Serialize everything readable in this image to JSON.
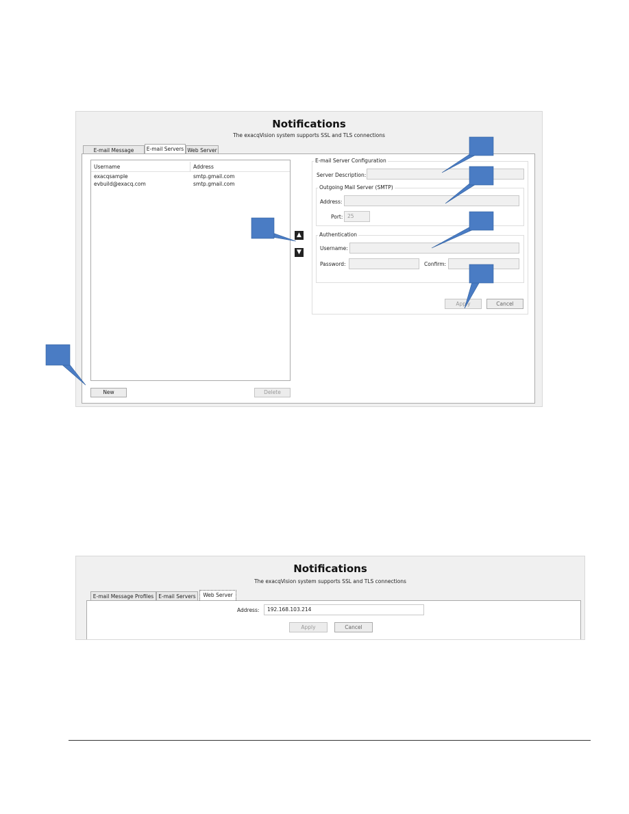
{
  "screen1": {
    "title": "Notifications",
    "subtitle": "The exacqVision system supports SSL and TLS connections",
    "tabs": [
      "E-mail Message Profiles",
      "E-mail Servers",
      "Web Server"
    ],
    "active_tab": "E-mail Servers",
    "list": {
      "columns": [
        "Username",
        "Address"
      ],
      "rows": [
        [
          "exacqsample",
          "smtp.gmail.com"
        ],
        [
          "evbuild@exacq.com",
          "smtp.gmail.com"
        ]
      ]
    },
    "new_label": "New",
    "delete_label": "Delete",
    "config": {
      "group_title": "E-mail Server Configuration",
      "server_description_label": "Server Description:",
      "smtp_title": "Outgoing Mail Server (SMTP)",
      "address_label": "Address:",
      "port_label": "Port:",
      "port_value": "25",
      "auth_title": "Authentication",
      "username_label": "Username:",
      "password_label": "Password:",
      "confirm_label": "Confirm:",
      "apply_label": "Apply",
      "cancel_label": "Cancel"
    },
    "icons": {
      "move_up": "arrow-up-icon",
      "move_down": "arrow-down-icon"
    }
  },
  "screen2": {
    "title": "Notifications",
    "subtitle": "The exacqVision system supports SSL and TLS connections",
    "tabs": [
      "E-mail Message Profiles",
      "E-mail Servers",
      "Web Server"
    ],
    "active_tab": "Web Server",
    "address_label": "Address:",
    "address_value": "192.168.103.214",
    "apply_label": "Apply",
    "cancel_label": "Cancel"
  },
  "colors": {
    "callout": "#4a7cc4",
    "window_bg": "#f0f0f0"
  }
}
